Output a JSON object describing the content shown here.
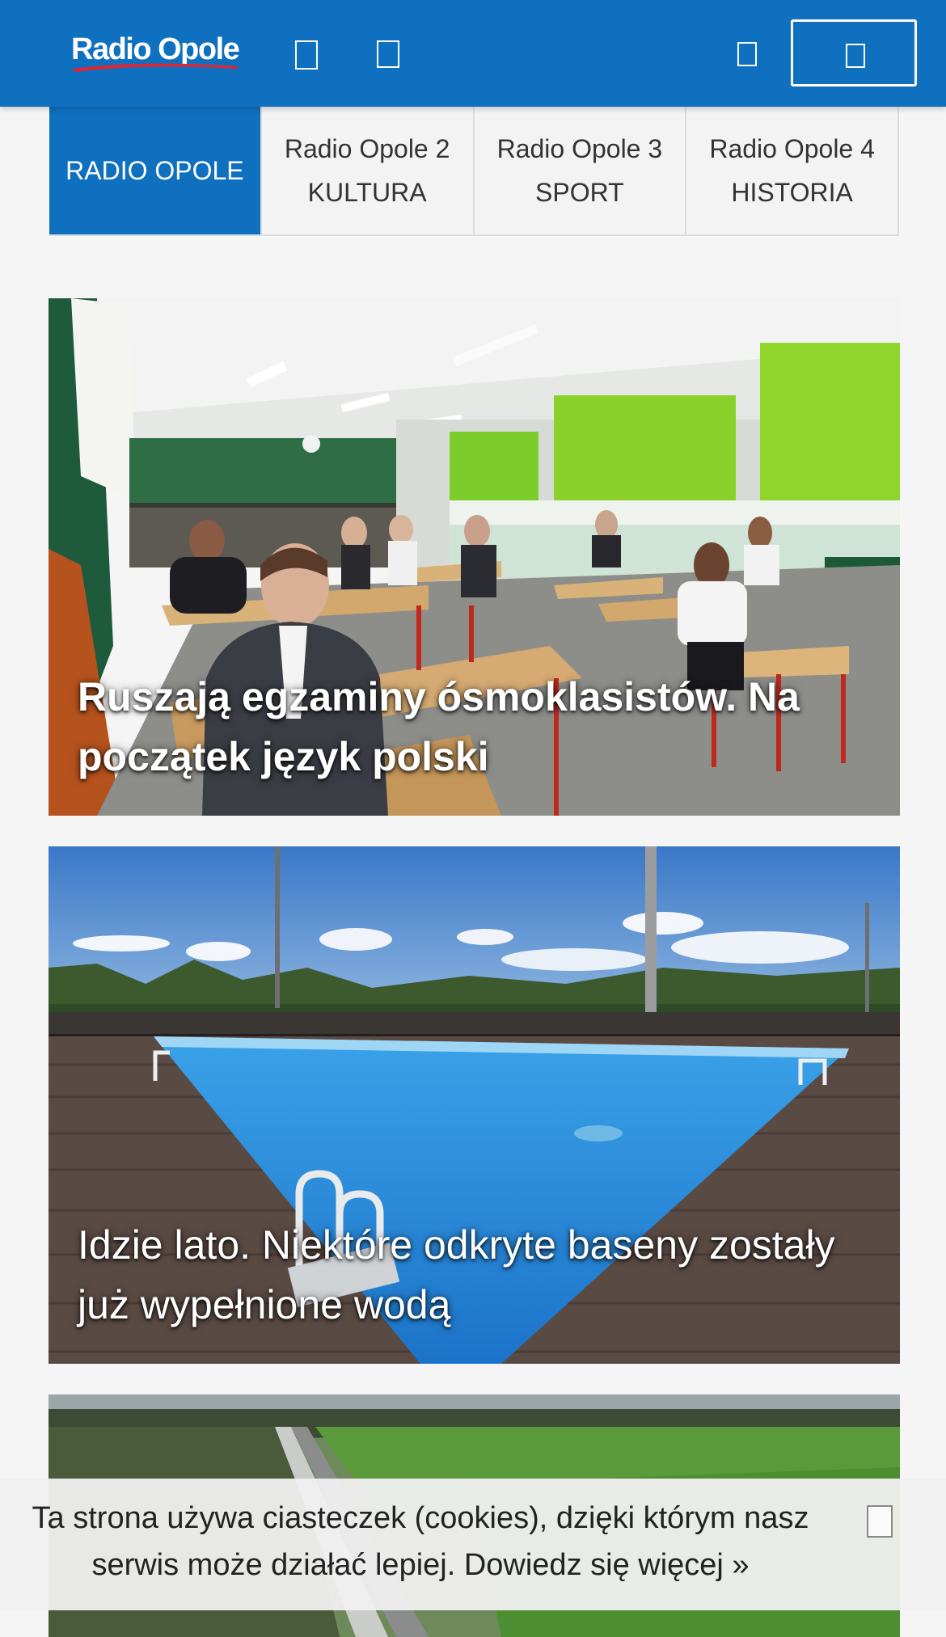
{
  "header": {
    "logo_text": "Radio Opole",
    "icons": [
      "menu-icon",
      "search-icon",
      "user-icon",
      "play-icon"
    ],
    "brand_color": "#0f70c0"
  },
  "tabs": [
    {
      "line1": "RADIO OPOLE",
      "line2": "",
      "active": true
    },
    {
      "line1": "Radio Opole 2",
      "line2": "KULTURA",
      "active": false
    },
    {
      "line1": "Radio Opole 3",
      "line2": "SPORT",
      "active": false
    },
    {
      "line1": "Radio Opole 4",
      "line2": "HISTORIA",
      "active": false
    }
  ],
  "articles": [
    {
      "title": "Ruszają egzaminy ósmoklasistów. Na początek język polski",
      "image": "classroom exam photo"
    },
    {
      "title": "Idzie lato. Niektóre odkryte baseny zostały już wypełnione wodą",
      "image": "outdoor swimming pool photo"
    },
    {
      "title": "",
      "image": "aerial road and fields photo"
    }
  ],
  "cookie_bar": {
    "text": "Ta strona używa ciasteczek (cookies), dzięki którym nasz serwis może działać lepiej. Dowiedz się więcej »",
    "close_icon": "close-icon"
  }
}
